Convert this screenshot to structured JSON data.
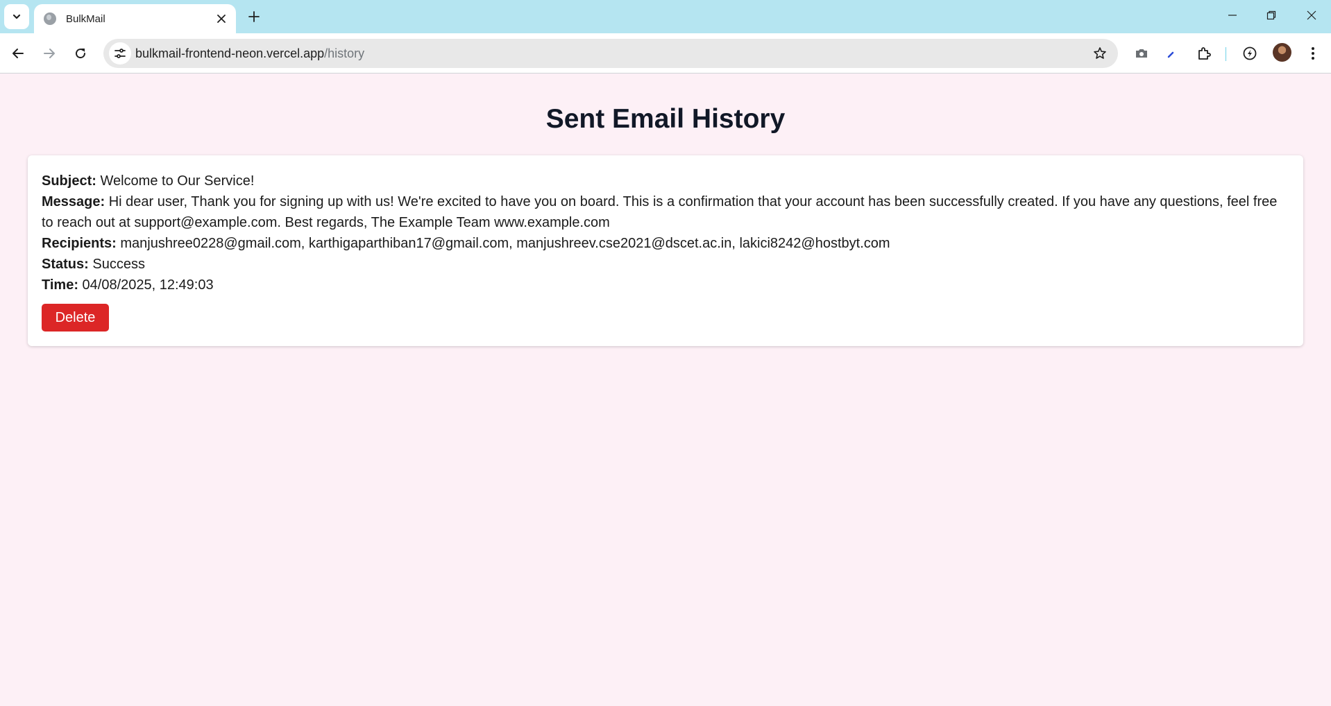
{
  "browser": {
    "tab": {
      "title": "BulkMail"
    },
    "url": {
      "host": "bulkmail-frontend-neon.vercel.app",
      "path": "/history"
    }
  },
  "page": {
    "title": "Sent Email History",
    "emails": [
      {
        "subject_label": "Subject:",
        "subject": "Welcome to Our Service!",
        "message_label": "Message:",
        "message": "Hi dear user, Thank you for signing up with us! We're excited to have you on board. This is a confirmation that your account has been successfully created. If you have any questions, feel free to reach out at support@example.com. Best regards, The Example Team www.example.com",
        "recipients_label": "Recipients:",
        "recipients": "manjushree0228@gmail.com, karthigaparthiban17@gmail.com, manjushreev.cse2021@dscet.ac.in, lakici8242@hostbyt.com",
        "status_label": "Status:",
        "status": "Success",
        "time_label": "Time:",
        "time": "04/08/2025, 12:49:03",
        "delete_label": "Delete"
      }
    ]
  },
  "colors": {
    "page_background": "#fdf0f6",
    "tabstrip": "#b5e5f1",
    "delete_button": "#dc2626"
  }
}
